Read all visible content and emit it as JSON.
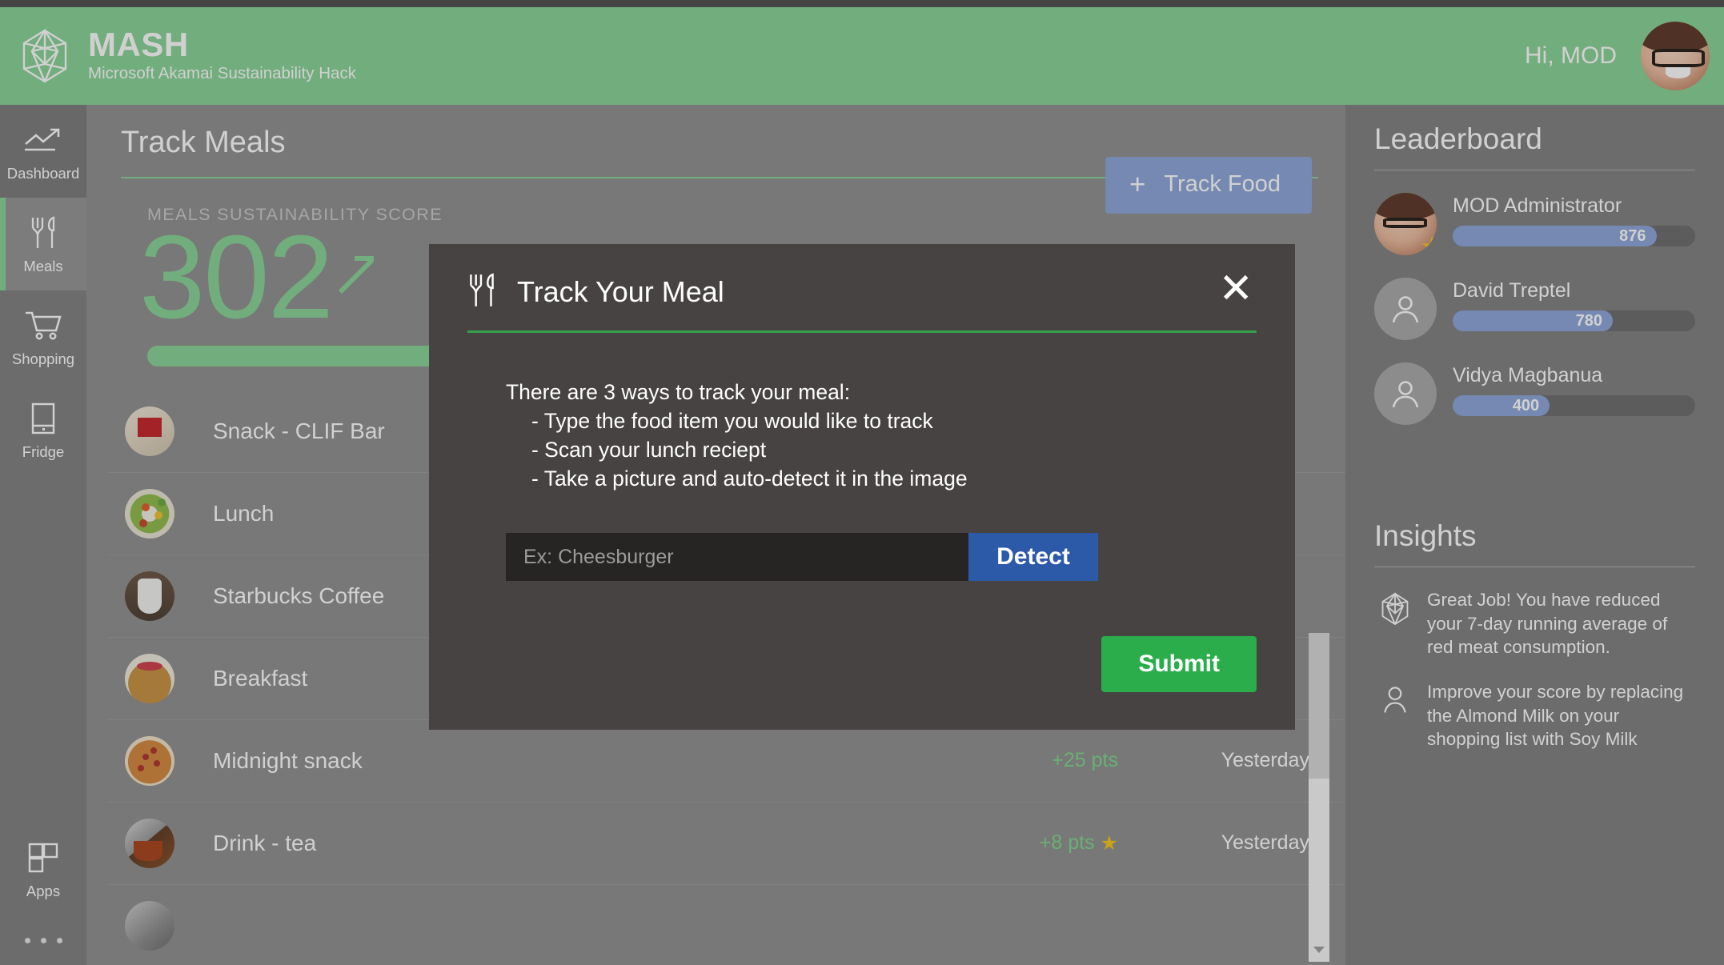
{
  "header": {
    "logo_icon": "polyhedron-logo-icon",
    "title": "MASH",
    "subtitle": "Microsoft Akamai Sustainability Hack",
    "greeting": "Hi, MOD",
    "avatar_icon": "user-avatar-photo"
  },
  "sidebar": {
    "items": [
      {
        "label": "Dashboard",
        "icon": "trend-arrow-icon"
      },
      {
        "label": "Meals",
        "icon": "fork-knife-icon"
      },
      {
        "label": "Shopping",
        "icon": "shopping-cart-icon"
      },
      {
        "label": "Fridge",
        "icon": "tablet-icon"
      }
    ],
    "bottom": {
      "label": "Apps",
      "icon": "apps-grid-icon",
      "more_icon": "more-dots-icon"
    }
  },
  "main": {
    "page_title": "Track Meals",
    "score_label": "MEALS SUSTAINABILITY SCORE",
    "score_value": "302",
    "score_trend_icon": "trend-up-arrow-icon",
    "track_food_button": "Track Food",
    "track_food_icon": "plus-icon",
    "meals": [
      {
        "name": "Snack - CLIF Bar",
        "points": "",
        "date": "",
        "star": false,
        "thumb": "th-clif"
      },
      {
        "name": "Lunch",
        "points": "",
        "date": "",
        "star": false,
        "thumb": "th-lunch"
      },
      {
        "name": "Starbucks Coffee",
        "points": "",
        "date": "",
        "star": false,
        "thumb": "th-coffee"
      },
      {
        "name": "Breakfast",
        "points": "",
        "date": "",
        "star": false,
        "thumb": "th-pancake"
      },
      {
        "name": "Midnight snack",
        "points": "+25 pts",
        "date": "Yesterday",
        "star": false,
        "thumb": "th-pizza"
      },
      {
        "name": "Drink - tea",
        "points": "+8 pts",
        "date": "Yesterday",
        "star": true,
        "thumb": "th-tea"
      },
      {
        "name": "",
        "points": "",
        "date": "",
        "star": false,
        "thumb": "th-next"
      }
    ]
  },
  "modal": {
    "title": "Track Your Meal",
    "title_icon": "fork-knife-icon",
    "close_icon": "close-x-icon",
    "intro": "There are 3 ways to track your meal:",
    "ways": [
      "- Type the food item you would like to track",
      "- Scan your lunch reciept",
      "- Take a picture and auto-detect it in the image"
    ],
    "input_placeholder": "Ex: Cheesburger",
    "input_value": "",
    "detect_button": "Detect",
    "submit_button": "Submit"
  },
  "leaderboard": {
    "title": "Leaderboard",
    "entries": [
      {
        "name": "MOD Administrator",
        "score": "876",
        "fill_pct": 84,
        "star": true,
        "avatar": "photo"
      },
      {
        "name": "David Treptel",
        "score": "780",
        "fill_pct": 66,
        "star": false,
        "avatar": "person-icon"
      },
      {
        "name": "Vidya Magbanua",
        "score": "400",
        "fill_pct": 40,
        "star": false,
        "avatar": "person-icon"
      }
    ]
  },
  "insights": {
    "title": "Insights",
    "items": [
      {
        "icon": "polyhedron-logo-icon",
        "text": "Great Job! You have reduced your 7-day running average of red meat consumption."
      },
      {
        "icon": "person-icon",
        "text": "Improve your score by replacing the Almond Milk on your shopping list with Soy Milk"
      }
    ]
  },
  "colors": {
    "brand_green": "#87d395",
    "accent_blue": "#8ba4da",
    "submit_green": "#2bad4b",
    "detect_blue": "#2d5aa8",
    "star_yellow": "#f5c518",
    "panel_gray": "#7f7f7f",
    "modal_gray": "#474342"
  }
}
